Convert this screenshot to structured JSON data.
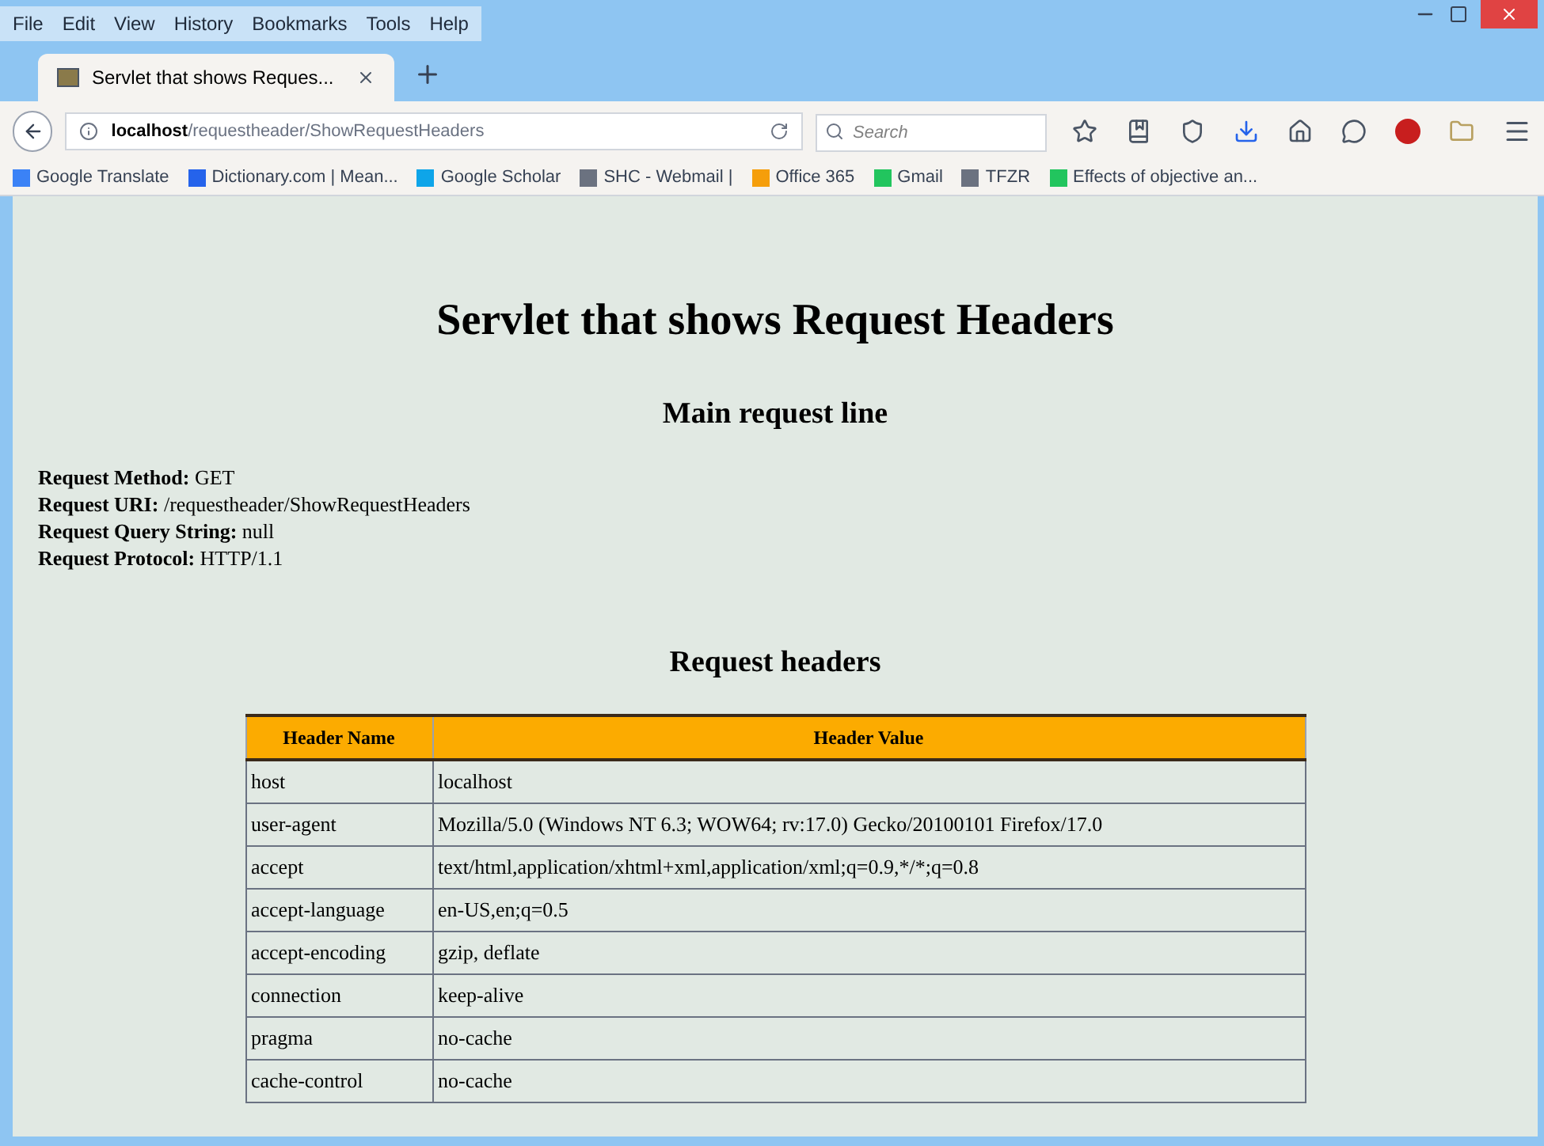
{
  "menu_bar": [
    "File",
    "Edit",
    "View",
    "History",
    "Bookmarks",
    "Tools",
    "Help"
  ],
  "tab": {
    "title": "Servlet that shows Reques...",
    "selected": true
  },
  "address_bar": {
    "url_host": "localhost",
    "url_path": "/requestheader/ShowRequestHeaders"
  },
  "search": {
    "placeholder": "Search"
  },
  "bookmarks": [
    "Google Translate",
    "Dictionary.com | Mean...",
    "Google Scholar",
    "SHC - Webmail |",
    "Office 365",
    "Gmail",
    "TFZR",
    "Effects of objective an..."
  ],
  "page": {
    "title": "Servlet that shows Request Headers",
    "main_heading": "Main request line",
    "request_lines": [
      {
        "label": "Request Method:",
        "value": "GET"
      },
      {
        "label": "Request URI:",
        "value": "/requestheader/ShowRequestHeaders"
      },
      {
        "label": "Request Query String:",
        "value": "null"
      },
      {
        "label": "Request Protocol:",
        "value": "HTTP/1.1"
      }
    ],
    "headers_heading": "Request headers",
    "table": {
      "columns": [
        "Header Name",
        "Header Value"
      ],
      "rows": [
        [
          "host",
          "localhost"
        ],
        [
          "user-agent",
          "Mozilla/5.0 (Windows NT 6.3; WOW64; rv:17.0) Gecko/20100101 Firefox/17.0"
        ],
        [
          "accept",
          "text/html,application/xhtml+xml,application/xml;q=0.9,*/*;q=0.8"
        ],
        [
          "accept-language",
          "en-US,en;q=0.5"
        ],
        [
          "accept-encoding",
          "gzip, deflate"
        ],
        [
          "connection",
          "keep-alive"
        ],
        [
          "pragma",
          "no-cache"
        ],
        [
          "cache-control",
          "no-cache"
        ]
      ]
    }
  }
}
